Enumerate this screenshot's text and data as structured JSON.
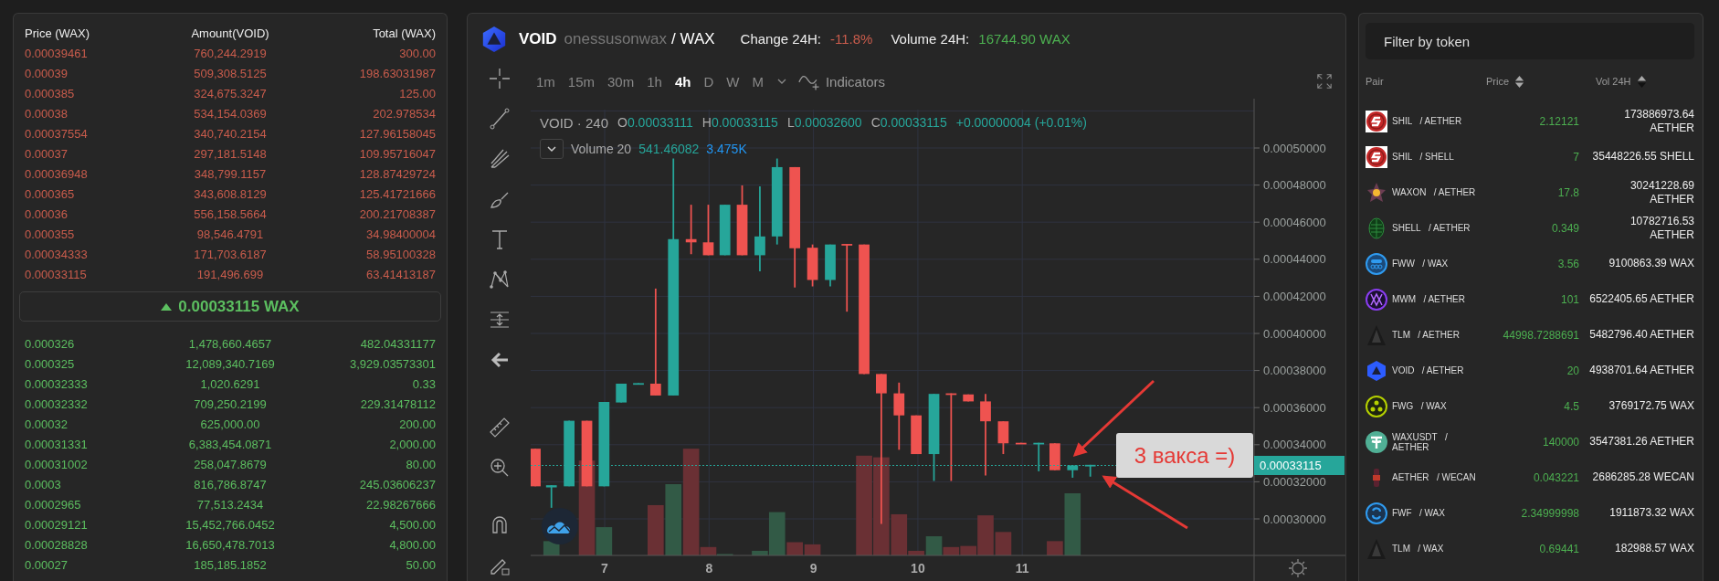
{
  "order_book": {
    "columns": [
      "Price (WAX)",
      "Amount(VOID)",
      "Total (WAX)"
    ],
    "asks": [
      {
        "price": "0.00039461",
        "amount": "760,244.2919",
        "total": "300.00"
      },
      {
        "price": "0.00039",
        "amount": "509,308.5125",
        "total": "198.63031987"
      },
      {
        "price": "0.000385",
        "amount": "324,675.3247",
        "total": "125.00"
      },
      {
        "price": "0.00038",
        "amount": "534,154.0369",
        "total": "202.978534"
      },
      {
        "price": "0.00037554",
        "amount": "340,740.2154",
        "total": "127.96158045"
      },
      {
        "price": "0.00037",
        "amount": "297,181.5148",
        "total": "109.95716047"
      },
      {
        "price": "0.00036948",
        "amount": "348,799.1157",
        "total": "128.87429724"
      },
      {
        "price": "0.000365",
        "amount": "343,608.8129",
        "total": "125.41721666"
      },
      {
        "price": "0.00036",
        "amount": "556,158.5664",
        "total": "200.21708387"
      },
      {
        "price": "0.000355",
        "amount": "98,546.4791",
        "total": "34.98400004"
      },
      {
        "price": "0.00034333",
        "amount": "171,703.6187",
        "total": "58.95100328"
      },
      {
        "price": "0.00033115",
        "amount": "191,496.699",
        "total": "63.41413187"
      }
    ],
    "last_price": {
      "text": "0.00033115 WAX",
      "rising": true
    },
    "bids": [
      {
        "price": "0.000326",
        "amount": "1,478,660.4657",
        "total": "482.04331177"
      },
      {
        "price": "0.000325",
        "amount": "12,089,340.7169",
        "total": "3,929.03573301"
      },
      {
        "price": "0.00032333",
        "amount": "1,020.6291",
        "total": "0.33"
      },
      {
        "price": "0.00032332",
        "amount": "709,250.2199",
        "total": "229.31478112"
      },
      {
        "price": "0.00032",
        "amount": "625,000.00",
        "total": "200.00"
      },
      {
        "price": "0.00031331",
        "amount": "6,383,454.0871",
        "total": "2,000.00"
      },
      {
        "price": "0.00031002",
        "amount": "258,047.8679",
        "total": "80.00"
      },
      {
        "price": "0.0003",
        "amount": "816,786.8747",
        "total": "245.03606237"
      },
      {
        "price": "0.0002965",
        "amount": "77,513.2434",
        "total": "22.98267666"
      },
      {
        "price": "0.00029121",
        "amount": "15,452,766.0452",
        "total": "4,500.00"
      },
      {
        "price": "0.00028828",
        "amount": "16,650,478.7013",
        "total": "4,800.00"
      },
      {
        "price": "0.00027",
        "amount": "185,185.1852",
        "total": "50.00"
      }
    ]
  },
  "chart": {
    "base": "VOID",
    "issuer": "onessusonwax",
    "quote": "/ WAX",
    "change_label": "Change 24H:",
    "change": "-11.8%",
    "volume_label": "Volume 24H:",
    "volume": "16744.90 WAX",
    "timeframes": [
      {
        "label": "1m",
        "selected": false
      },
      {
        "label": "15m",
        "selected": false
      },
      {
        "label": "30m",
        "selected": false
      },
      {
        "label": "1h",
        "selected": false
      },
      {
        "label": "4h",
        "selected": true
      },
      {
        "label": "D",
        "selected": false
      },
      {
        "label": "W",
        "selected": false
      },
      {
        "label": "M",
        "selected": false
      }
    ],
    "indicators": "Indicators",
    "legend": {
      "title": "VOID · 240",
      "values": [
        {
          "key": "O",
          "value": "0.00033111"
        },
        {
          "key": "H",
          "value": "0.00033115"
        },
        {
          "key": "L",
          "value": "0.00032600"
        },
        {
          "key": "C",
          "value": "0.00033115"
        }
      ],
      "change": "+0.00000004 (+0.01%)"
    },
    "volume_legend": {
      "label": "Volume 20",
      "value": "541.46082",
      "average": "3.475K"
    },
    "price_axis": [
      "0.00050000",
      "0.00048000",
      "0.00046000",
      "0.00044000",
      "0.00042000",
      "0.00040000",
      "0.00038000",
      "0.00036000",
      "0.00034000",
      "0.00032000",
      "0.00030000"
    ],
    "time_axis": [
      "7",
      "8",
      "9",
      "10",
      "11"
    ],
    "last_price_tag": "0.00033115",
    "annotation": "3 вакса =)"
  },
  "markets": {
    "filter": {
      "placeholder": "Filter by token"
    },
    "columns": [
      "Pair",
      "Price",
      "Vol 24H"
    ],
    "rows": [
      {
        "base": "SHIL",
        "quote": "/ AETHER",
        "price": "2.12121",
        "volume": "173886973.64 AETHER"
      },
      {
        "base": "SHIL",
        "quote": "/ SHELL",
        "price": "7",
        "volume": "35448226.55 SHELL"
      },
      {
        "base": "WAXON",
        "quote": "/ AETHER",
        "price": "17.8",
        "volume": "30241228.69 AETHER"
      },
      {
        "base": "SHELL",
        "quote": "/ AETHER",
        "price": "0.349",
        "volume": "10782716.53 AETHER"
      },
      {
        "base": "FWW",
        "quote": "/ WAX",
        "price": "3.56",
        "volume": "9100863.39 WAX"
      },
      {
        "base": "MWM",
        "quote": "/ AETHER",
        "price": "101",
        "volume": "6522405.65 AETHER"
      },
      {
        "base": "TLM",
        "quote": "/ AETHER",
        "price": "44998.7288691",
        "volume": "5482796.40 AETHER"
      },
      {
        "base": "VOID",
        "quote": "/ AETHER",
        "price": "20",
        "volume": "4938701.64 AETHER"
      },
      {
        "base": "FWG",
        "quote": "/ WAX",
        "price": "4.5",
        "volume": "3769172.75 WAX"
      },
      {
        "base": "WAXUSDT",
        "quote": "/ AETHER",
        "price": "140000",
        "volume": "3547381.26 AETHER"
      },
      {
        "base": "AETHER",
        "quote": "/ WECAN",
        "price": "0.043221",
        "volume": "2686285.28 WECAN"
      },
      {
        "base": "FWF",
        "quote": "/ WAX",
        "price": "2.34999998",
        "volume": "1911873.32 WAX"
      },
      {
        "base": "TLM",
        "quote": "/ WAX",
        "price": "0.69441",
        "volume": "182988.57 WAX"
      }
    ]
  }
}
